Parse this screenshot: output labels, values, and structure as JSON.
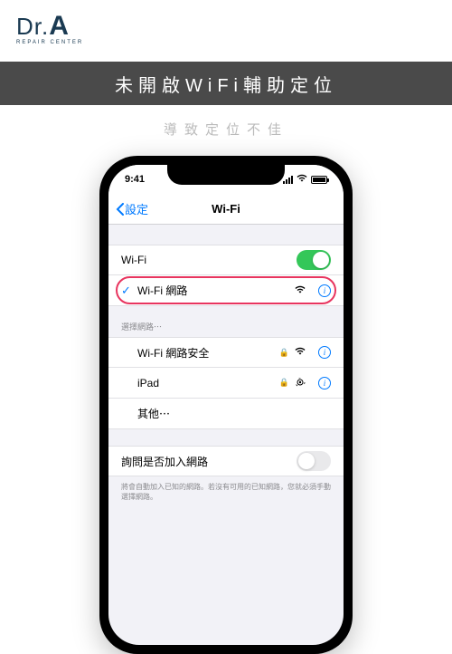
{
  "logo": {
    "main": "Dr.",
    "bold": "A",
    "sub": "REPAIR CENTER"
  },
  "banner": "未開啟WiFi輔助定位",
  "subtitle": "導致定位不佳",
  "status": {
    "time": "9:41"
  },
  "nav": {
    "back": "設定",
    "title": "Wi-Fi"
  },
  "rows": {
    "wifi_label": "Wi-Fi",
    "connected": "Wi-Fi 網路",
    "section": "選擇網路⋯",
    "net1": "Wi-Fi 網路安全",
    "net2": "iPad",
    "other": "其他⋯",
    "ask": "詢問是否加入網路",
    "footer": "將會自動加入已知的網路。若沒有可用的已知網路，您就必須手動選擇網路。"
  }
}
